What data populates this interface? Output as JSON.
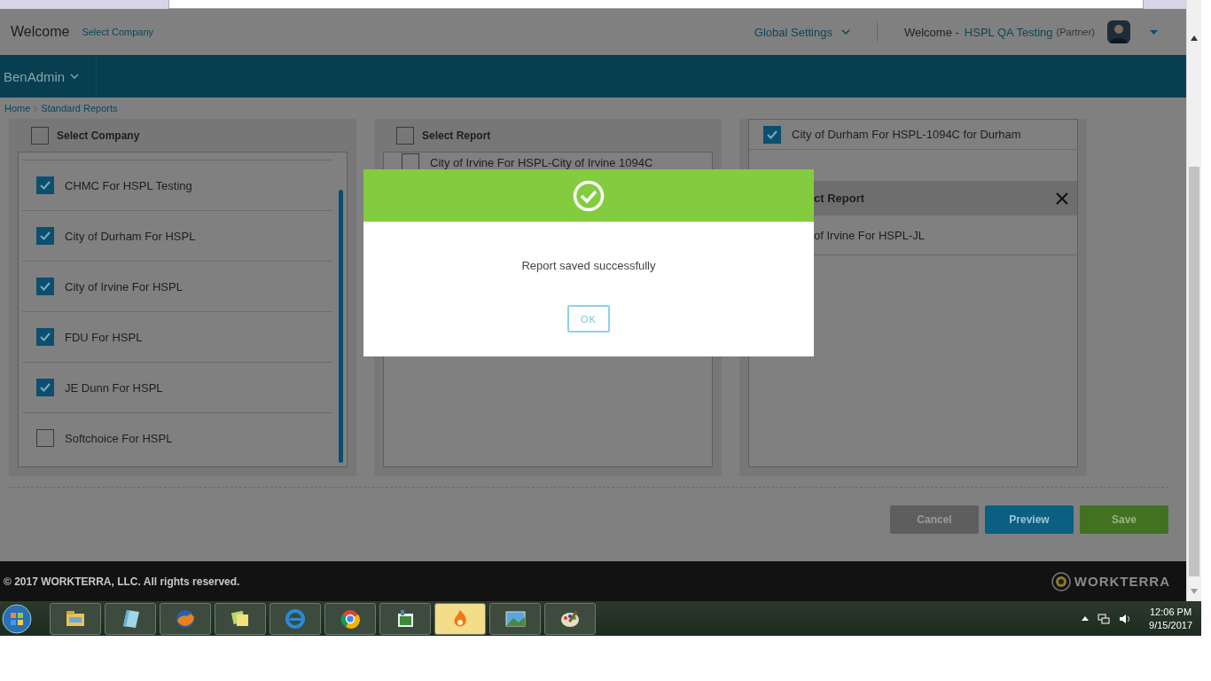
{
  "header": {
    "welcome": "Welcome",
    "select_company": "Select Company",
    "global_settings": "Global Settings",
    "welcome_user": "Welcome -",
    "user_name": "HSPL QA Testing",
    "user_role": "(Partner)"
  },
  "nav": {
    "module": "BenAdmin"
  },
  "breadcrumb": [
    "Home",
    "Standard Reports"
  ],
  "company_panel": {
    "select_all": {
      "label": "Select Company",
      "checked": false
    },
    "items": [
      {
        "label": "CHMC For HSPL Testing",
        "checked": true
      },
      {
        "label": "City of Durham For HSPL",
        "checked": true
      },
      {
        "label": "City of Irvine For HSPL",
        "checked": true
      },
      {
        "label": "FDU For HSPL",
        "checked": true
      },
      {
        "label": "JE Dunn For HSPL",
        "checked": true
      },
      {
        "label": "Softchoice For HSPL",
        "checked": false
      }
    ]
  },
  "report_panel": {
    "select_all": {
      "label": "Select Report",
      "checked": false
    },
    "items": [
      {
        "label": "City of Irvine For HSPL-City of Irvine 1094C",
        "checked": false
      }
    ]
  },
  "selected_panel": {
    "items": [
      {
        "label": "City of Durham For HSPL-1094C for Durham",
        "checked": true
      }
    ],
    "section_title": "ct Report",
    "section_items": [
      "of Irvine For HSPL-JL"
    ]
  },
  "buttons": [
    {
      "label": "Cancel",
      "kind": "cancel"
    },
    {
      "label": "Preview",
      "kind": "preview"
    },
    {
      "label": "Save",
      "kind": "save"
    }
  ],
  "footer": {
    "copyright": "© 2017 WORKTERRA, LLC. All rights reserved.",
    "logo": "WORKTERRA"
  },
  "dialog": {
    "message": "Report saved successfully",
    "button": "OK"
  },
  "taskbar": {
    "time": "12:06 PM",
    "date": "9/15/2017"
  }
}
